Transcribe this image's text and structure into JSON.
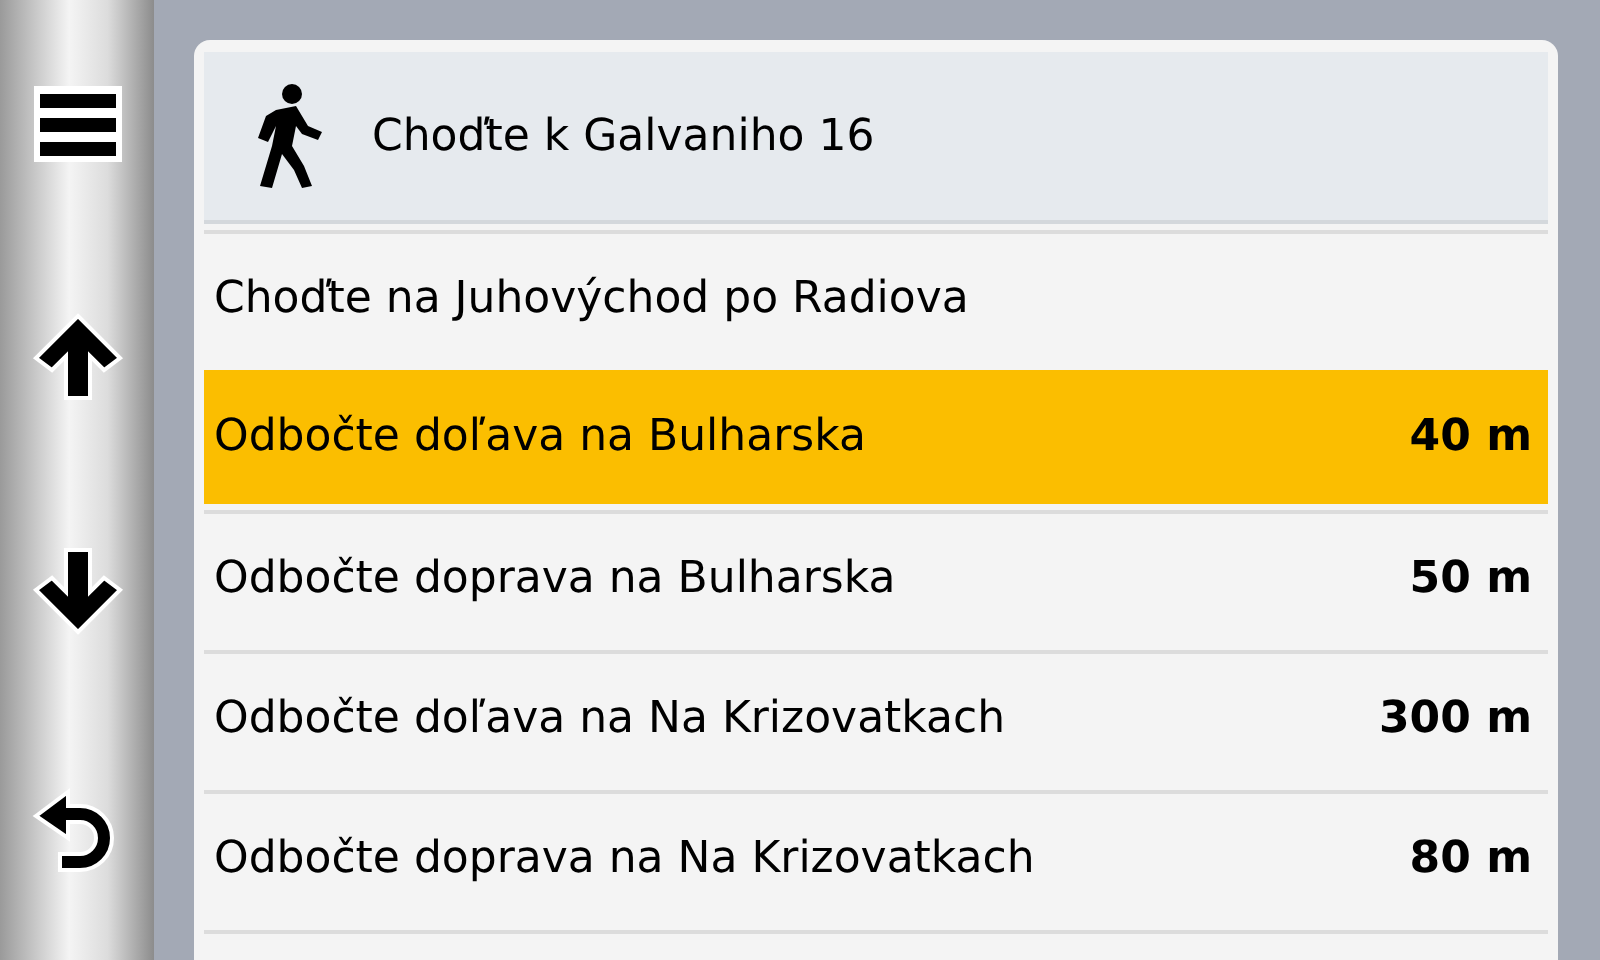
{
  "header": {
    "text": "Choďte k Galvaniho 16"
  },
  "steps": [
    {
      "text": "Choďte na Juhovýchod po Radiova",
      "selected": false
    },
    {
      "text": "Odbočte doľava na Bulharska",
      "distance": "40 m",
      "selected": true
    },
    {
      "text": "Odbočte doprava na Bulharska",
      "distance": "50 m",
      "selected": false
    },
    {
      "text": "Odbočte doľava na Na Krizovatkach",
      "distance": "300 m",
      "selected": false
    },
    {
      "text": "Odbočte doprava na Na Krizovatkach",
      "distance": "80 m",
      "selected": false
    }
  ]
}
